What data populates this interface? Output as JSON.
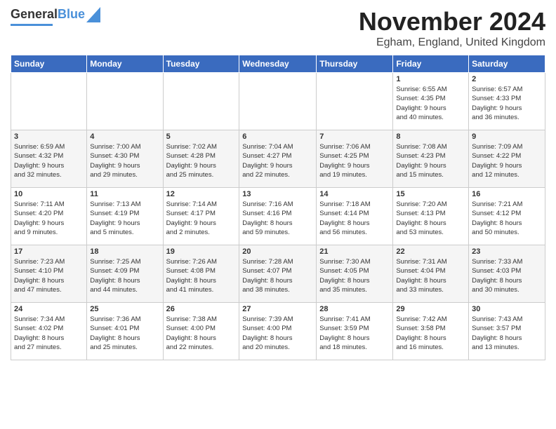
{
  "header": {
    "logo_general": "General",
    "logo_blue": "Blue",
    "month": "November 2024",
    "location": "Egham, England, United Kingdom"
  },
  "weekdays": [
    "Sunday",
    "Monday",
    "Tuesday",
    "Wednesday",
    "Thursday",
    "Friday",
    "Saturday"
  ],
  "weeks": [
    [
      {
        "day": "",
        "info": ""
      },
      {
        "day": "",
        "info": ""
      },
      {
        "day": "",
        "info": ""
      },
      {
        "day": "",
        "info": ""
      },
      {
        "day": "",
        "info": ""
      },
      {
        "day": "1",
        "info": "Sunrise: 6:55 AM\nSunset: 4:35 PM\nDaylight: 9 hours\nand 40 minutes."
      },
      {
        "day": "2",
        "info": "Sunrise: 6:57 AM\nSunset: 4:33 PM\nDaylight: 9 hours\nand 36 minutes."
      }
    ],
    [
      {
        "day": "3",
        "info": "Sunrise: 6:59 AM\nSunset: 4:32 PM\nDaylight: 9 hours\nand 32 minutes."
      },
      {
        "day": "4",
        "info": "Sunrise: 7:00 AM\nSunset: 4:30 PM\nDaylight: 9 hours\nand 29 minutes."
      },
      {
        "day": "5",
        "info": "Sunrise: 7:02 AM\nSunset: 4:28 PM\nDaylight: 9 hours\nand 25 minutes."
      },
      {
        "day": "6",
        "info": "Sunrise: 7:04 AM\nSunset: 4:27 PM\nDaylight: 9 hours\nand 22 minutes."
      },
      {
        "day": "7",
        "info": "Sunrise: 7:06 AM\nSunset: 4:25 PM\nDaylight: 9 hours\nand 19 minutes."
      },
      {
        "day": "8",
        "info": "Sunrise: 7:08 AM\nSunset: 4:23 PM\nDaylight: 9 hours\nand 15 minutes."
      },
      {
        "day": "9",
        "info": "Sunrise: 7:09 AM\nSunset: 4:22 PM\nDaylight: 9 hours\nand 12 minutes."
      }
    ],
    [
      {
        "day": "10",
        "info": "Sunrise: 7:11 AM\nSunset: 4:20 PM\nDaylight: 9 hours\nand 9 minutes."
      },
      {
        "day": "11",
        "info": "Sunrise: 7:13 AM\nSunset: 4:19 PM\nDaylight: 9 hours\nand 5 minutes."
      },
      {
        "day": "12",
        "info": "Sunrise: 7:14 AM\nSunset: 4:17 PM\nDaylight: 9 hours\nand 2 minutes."
      },
      {
        "day": "13",
        "info": "Sunrise: 7:16 AM\nSunset: 4:16 PM\nDaylight: 8 hours\nand 59 minutes."
      },
      {
        "day": "14",
        "info": "Sunrise: 7:18 AM\nSunset: 4:14 PM\nDaylight: 8 hours\nand 56 minutes."
      },
      {
        "day": "15",
        "info": "Sunrise: 7:20 AM\nSunset: 4:13 PM\nDaylight: 8 hours\nand 53 minutes."
      },
      {
        "day": "16",
        "info": "Sunrise: 7:21 AM\nSunset: 4:12 PM\nDaylight: 8 hours\nand 50 minutes."
      }
    ],
    [
      {
        "day": "17",
        "info": "Sunrise: 7:23 AM\nSunset: 4:10 PM\nDaylight: 8 hours\nand 47 minutes."
      },
      {
        "day": "18",
        "info": "Sunrise: 7:25 AM\nSunset: 4:09 PM\nDaylight: 8 hours\nand 44 minutes."
      },
      {
        "day": "19",
        "info": "Sunrise: 7:26 AM\nSunset: 4:08 PM\nDaylight: 8 hours\nand 41 minutes."
      },
      {
        "day": "20",
        "info": "Sunrise: 7:28 AM\nSunset: 4:07 PM\nDaylight: 8 hours\nand 38 minutes."
      },
      {
        "day": "21",
        "info": "Sunrise: 7:30 AM\nSunset: 4:05 PM\nDaylight: 8 hours\nand 35 minutes."
      },
      {
        "day": "22",
        "info": "Sunrise: 7:31 AM\nSunset: 4:04 PM\nDaylight: 8 hours\nand 33 minutes."
      },
      {
        "day": "23",
        "info": "Sunrise: 7:33 AM\nSunset: 4:03 PM\nDaylight: 8 hours\nand 30 minutes."
      }
    ],
    [
      {
        "day": "24",
        "info": "Sunrise: 7:34 AM\nSunset: 4:02 PM\nDaylight: 8 hours\nand 27 minutes."
      },
      {
        "day": "25",
        "info": "Sunrise: 7:36 AM\nSunset: 4:01 PM\nDaylight: 8 hours\nand 25 minutes."
      },
      {
        "day": "26",
        "info": "Sunrise: 7:38 AM\nSunset: 4:00 PM\nDaylight: 8 hours\nand 22 minutes."
      },
      {
        "day": "27",
        "info": "Sunrise: 7:39 AM\nSunset: 4:00 PM\nDaylight: 8 hours\nand 20 minutes."
      },
      {
        "day": "28",
        "info": "Sunrise: 7:41 AM\nSunset: 3:59 PM\nDaylight: 8 hours\nand 18 minutes."
      },
      {
        "day": "29",
        "info": "Sunrise: 7:42 AM\nSunset: 3:58 PM\nDaylight: 8 hours\nand 16 minutes."
      },
      {
        "day": "30",
        "info": "Sunrise: 7:43 AM\nSunset: 3:57 PM\nDaylight: 8 hours\nand 13 minutes."
      }
    ]
  ]
}
